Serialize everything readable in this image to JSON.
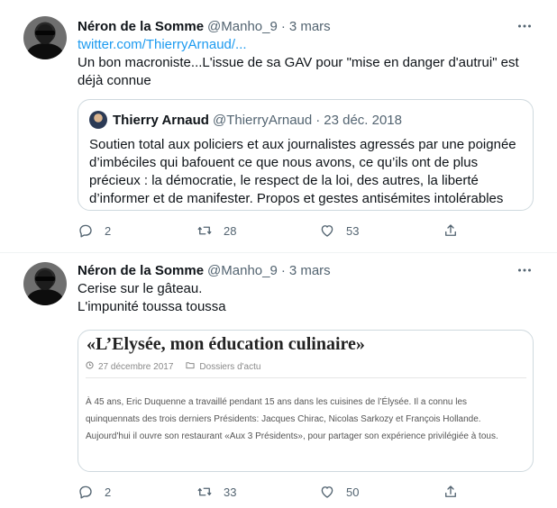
{
  "tweets": [
    {
      "name": "Néron de la Somme",
      "handle": "@Manho_9",
      "date": "3 mars",
      "link": "twitter.com/ThierryArnaud/...",
      "text": "Un bon macroniste...L'issue de sa GAV pour \"mise en danger d'autrui\" est déjà connue",
      "quote": {
        "name": "Thierry Arnaud",
        "handle": "@ThierryArnaud",
        "date": "23 déc. 2018",
        "text": "Soutien total aux policiers et aux journalistes agressés par une poignée d’imbéciles qui bafouent ce que nous avons, ce qu’ils ont de plus précieux : la démocratie, le respect de la loi, des autres, la liberté d’informer et de manifester. Propos et gestes antisémites intolérables"
      },
      "replies": "2",
      "retweets": "28",
      "likes": "53"
    },
    {
      "name": "Néron de la Somme",
      "handle": "@Manho_9",
      "date": "3 mars",
      "line1": "Cerise sur le gâteau.",
      "line2": "L'impunité toussa toussa",
      "card": {
        "title": "«L’Elysée, mon éducation culinaire»",
        "date": "27 décembre 2017",
        "category": "Dossiers d'actu",
        "body": "À 45 ans, Eric Duquenne a travaillé pendant 15 ans dans les cuisines de l’Élysée. Il a connu les quinquennats des trois derniers Présidents: Jacques Chirac, Nicolas Sarkozy et François Hollande. Aujourd'hui il ouvre son restaurant «Aux 3 Présidents», pour partager son expérience privilégiée à tous."
      },
      "replies": "2",
      "retweets": "33",
      "likes": "50"
    }
  ],
  "icons": {
    "more": "more-icon",
    "reply": "reply-icon",
    "retweet": "retweet-icon",
    "like": "like-icon",
    "share": "share-icon",
    "clock": "clock-icon",
    "folder": "folder-icon"
  },
  "colors": {
    "link": "#1d9bf0",
    "secondary": "#536471",
    "border": "#cfd9de"
  }
}
